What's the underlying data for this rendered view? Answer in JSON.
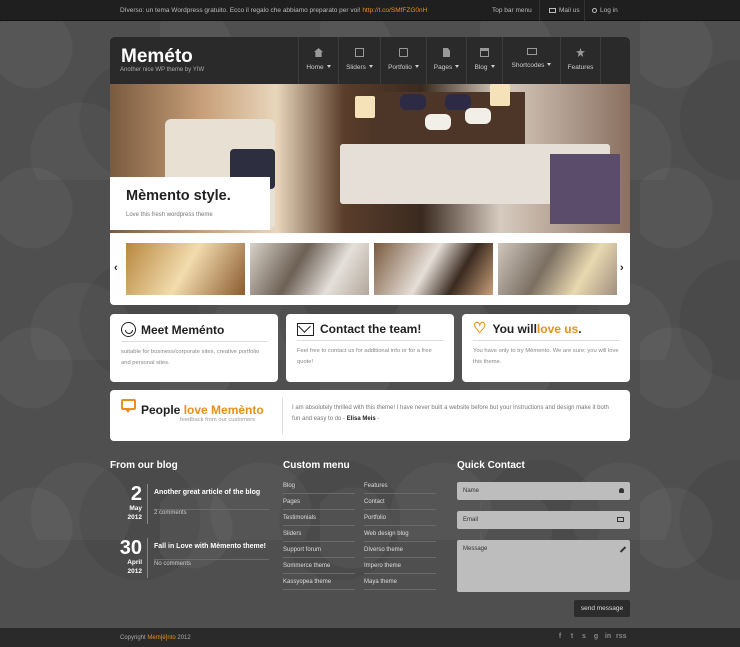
{
  "topbar": {
    "message_prefix": "DIverso: un tema Wordpress gratuito. Ecco il regalo che abbiamo preparato per voi!",
    "message_link": "http://t.co/SMfFZG0nH",
    "menu_label": "Top bar menu",
    "mail_label": "Mail us",
    "login_label": "Log in"
  },
  "header": {
    "logo": "Meméto",
    "tagline": "Another nice WP theme by YIW",
    "nav": [
      {
        "label": "Home",
        "icon": "home-icon",
        "dropdown": true
      },
      {
        "label": "Sliders",
        "icon": "film-icon",
        "dropdown": true
      },
      {
        "label": "Portfolio",
        "icon": "picture-icon",
        "dropdown": true
      },
      {
        "label": "Pages",
        "icon": "page-icon",
        "dropdown": true
      },
      {
        "label": "Blog",
        "icon": "blog-icon",
        "dropdown": true
      },
      {
        "label": "Shortcodes",
        "icon": "code-icon",
        "dropdown": true
      },
      {
        "label": "Features",
        "icon": "star-icon",
        "dropdown": false
      }
    ]
  },
  "hero": {
    "title": "Mèmento style.",
    "subtitle": "Love this fresh wordpress theme",
    "prev_arrow": "‹",
    "next_arrow": "›"
  },
  "features": [
    {
      "title": "Meet Meménto",
      "accent": "",
      "icon": "smile-icon",
      "text": "suitable for business/corporate sites, creative portfolio and personal sites."
    },
    {
      "title": "Contact the team!",
      "accent": "",
      "icon": "envelope-icon",
      "text": "Feel free to contact us for additional info or for a free quote!"
    },
    {
      "title": "You will ",
      "accent": "love us",
      "suffix": ".",
      "icon": "heart-icon",
      "text": "You have only to try Mèmento. We are sure: you will love this theme."
    }
  ],
  "testimonial": {
    "title_prefix": "People ",
    "title_accent": "love Memènto",
    "subtitle": "feedback from our customers",
    "quote": "I am absolutely thrilled with this theme! I have never built a website before but your instructions and design make it both fun and easy to do -",
    "author": "Elisa Meis",
    "author_suffix": " -"
  },
  "blog": {
    "title": "From our blog",
    "posts": [
      {
        "day": "2",
        "month": "May",
        "year": "2012",
        "title": "Another great article of the blog",
        "comments": "2 comments"
      },
      {
        "day": "30",
        "month": "April",
        "year": "2012",
        "title": "Fall in Love with Mèmento theme!",
        "comments": "No comments"
      }
    ]
  },
  "custom_menu": {
    "title": "Custom menu",
    "col1": [
      "Blog",
      "Pages",
      "Testimonials",
      "Sliders",
      "Support forum",
      "Sommerce theme",
      "Kassyopea theme"
    ],
    "col2": [
      "Features",
      "Contact",
      "Portfolio",
      "Web design blog",
      "DIverso theme",
      "Impero theme",
      "Maya theme"
    ]
  },
  "quick_contact": {
    "title": "Quick Contact",
    "name_placeholder": "Name",
    "email_placeholder": "Email",
    "message_placeholder": "Message",
    "send_label": "send message"
  },
  "footer": {
    "copyright_prefix": "Copyright ",
    "brand": "Mem[é]nto",
    "year": " 2012",
    "social": [
      "f",
      "t",
      "s",
      "g",
      "in",
      "rss"
    ]
  },
  "colors": {
    "accent": "#e8901a",
    "background": "#4f4f4f",
    "header": "#2a2a2a"
  }
}
